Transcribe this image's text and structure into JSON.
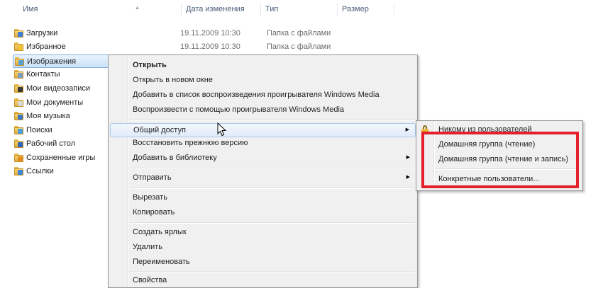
{
  "columns": {
    "name": "Имя",
    "date": "Дата изменения",
    "type": "Тип",
    "size": "Размер"
  },
  "files": [
    {
      "name": "Загрузки",
      "date": "19.11.2009 10:30",
      "type": "Папка с файлами",
      "badge": "#3d7dd8",
      "icon": "downloads-folder-icon"
    },
    {
      "name": "Избранное",
      "date": "19.11.2009 10:30",
      "type": "Папка с файлами",
      "badge": "#f0c030",
      "icon": "favorites-folder-icon"
    },
    {
      "name": "Изображения",
      "date": "",
      "type": "",
      "badge": "#58a0d8",
      "icon": "pictures-folder-icon"
    },
    {
      "name": "Контакты",
      "date": "",
      "type": "",
      "badge": "#7a9bc2",
      "icon": "contacts-folder-icon"
    },
    {
      "name": "Мои видеозаписи",
      "date": "",
      "type": "",
      "badge": "#3a3a3a",
      "icon": "videos-folder-icon"
    },
    {
      "name": "Мои документы",
      "date": "",
      "type": "",
      "badge": "#d9d9d9",
      "icon": "documents-folder-icon"
    },
    {
      "name": "Моя музыка",
      "date": "",
      "type": "",
      "badge": "#3a74c4",
      "icon": "music-folder-icon"
    },
    {
      "name": "Поиски",
      "date": "",
      "type": "",
      "badge": "#4aa0e0",
      "icon": "searches-folder-icon"
    },
    {
      "name": "Рабочий стол",
      "date": "",
      "type": "",
      "badge": "#2d66b8",
      "icon": "desktop-folder-icon"
    },
    {
      "name": "Сохраненные игры",
      "date": "",
      "type": "",
      "badge": "#e58a1f",
      "icon": "saved-games-folder-icon"
    },
    {
      "name": "Ссылки",
      "date": "",
      "type": "",
      "badge": "#3b86d6",
      "icon": "links-folder-icon"
    }
  ],
  "context_menu": {
    "open": "Открыть",
    "open_new_window": "Открыть в новом окне",
    "add_to_playlist": "Добавить в список воспроизведения проигрывателя Windows Media",
    "play_with": "Воспроизвести с помощью проигрывателя Windows Media",
    "share": "Общий доступ",
    "restore": "Восстановить прежнюю версию",
    "add_to_library": "Добавить в библиотеку",
    "send_to": "Отправить",
    "cut": "Вырезать",
    "copy": "Копировать",
    "create_shortcut": "Создать ярлык",
    "delete": "Удалить",
    "rename": "Переименовать",
    "properties": "Свойства"
  },
  "share_submenu": {
    "nobody": "Никому из пользователей",
    "homegroup_read": "Домашняя группа (чтение)",
    "homegroup_readwrite": "Домашняя группа (чтение и запись)",
    "specific_people": "Конкретные пользователи..."
  },
  "colors": {
    "highlight": "#e5202a",
    "selection_border": "#84acdd"
  }
}
